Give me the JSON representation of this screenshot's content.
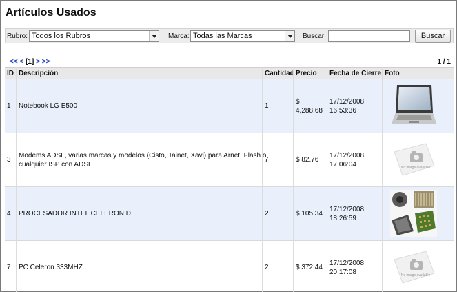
{
  "page": {
    "title": "Artículos Usados"
  },
  "filters": {
    "rubro_label": "Rubro:",
    "rubro_value": "Todos los Rubros",
    "marca_label": "Marca:",
    "marca_value": "Todas las Marcas",
    "buscar_label": "Buscar:",
    "buscar_value": "",
    "buscar_button": "Buscar"
  },
  "pager": {
    "first": "<<",
    "prev": "<",
    "current": "[1]",
    "next": ">",
    "last": ">>",
    "page_count": "1 / 1"
  },
  "table": {
    "headers": {
      "id": "ID",
      "descripcion": "Descripción",
      "cantidad": "Cantidad",
      "precio": "Precio",
      "fecha": "Fecha de Cierre",
      "foto": "Foto"
    },
    "rows": [
      {
        "id": "1",
        "desc1": "Notebook LG E500",
        "desc2": "",
        "cantidad": "1",
        "precio1": "$",
        "precio2": "4,288.68",
        "fecha1": "17/12/2008",
        "fecha2": "16:53:36",
        "foto": "laptop-photo"
      },
      {
        "id": "3",
        "desc1": "Modems ADSL, varias marcas y modelos (Cisto, Tainet, Xavi) para Arnet, Flash o",
        "desc2": "cualquier ISP con ADSL",
        "cantidad": "7",
        "precio1": "$ 82.76",
        "precio2": "",
        "fecha1": "17/12/2008",
        "fecha2": "17:06:04",
        "foto": "no-image"
      },
      {
        "id": "4",
        "desc1": "PROCESADOR INTEL CELERON D",
        "desc2": "",
        "cantidad": "2",
        "precio1": "$ 105.34",
        "precio2": "",
        "fecha1": "17/12/2008",
        "fecha2": "18:26:59",
        "foto": "processor-photo"
      },
      {
        "id": "7",
        "desc1": "PC Celeron 333MHZ",
        "desc2": "",
        "cantidad": "2",
        "precio1": "$ 372.44",
        "precio2": "",
        "fecha1": "17/12/2008",
        "fecha2": "20:17:08",
        "foto": "no-image"
      }
    ],
    "no_image_text": "No image available"
  },
  "colors": {
    "link": "#1c3fbf",
    "row_alt": "#eaf0fb",
    "header_bg": "#e8e8e8"
  }
}
